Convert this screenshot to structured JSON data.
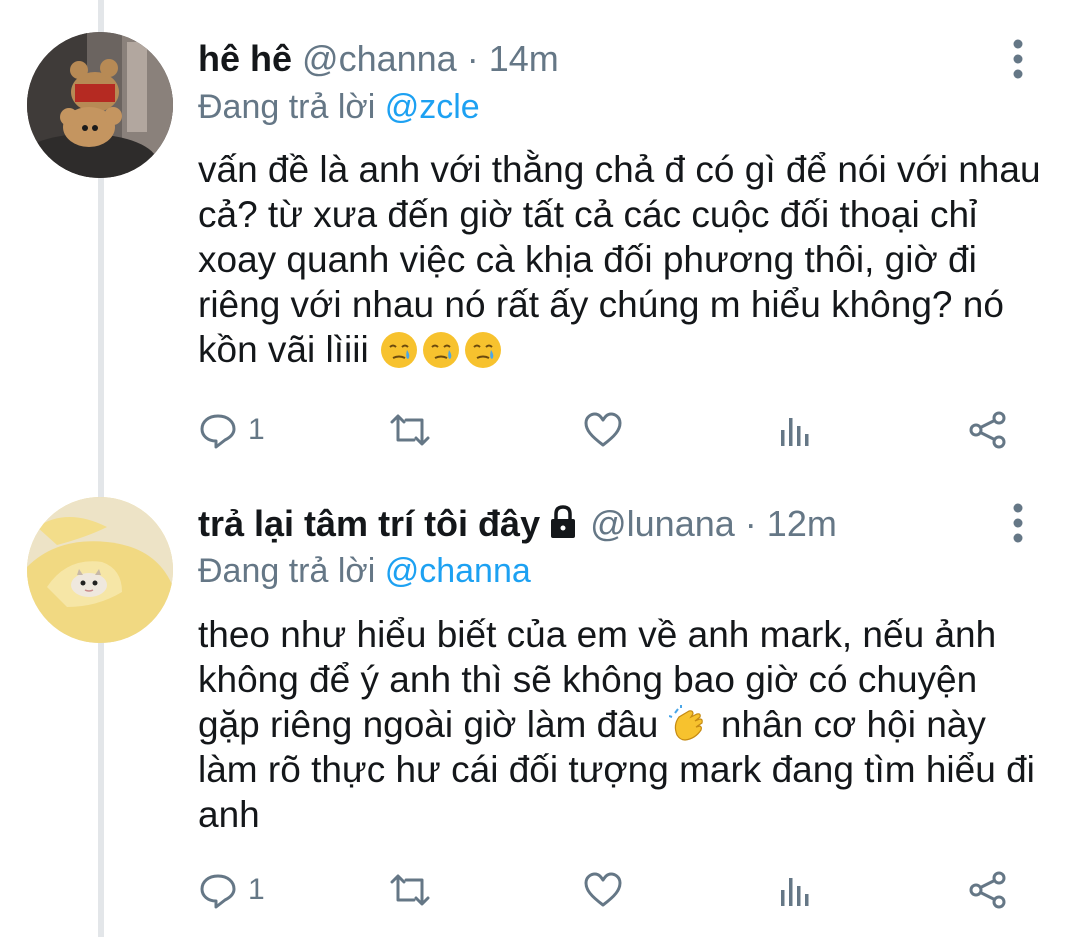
{
  "tweets": [
    {
      "name": "hê hê",
      "handle": "@channa",
      "separator": "·",
      "time": "14m",
      "replying_prefix": "Đang trả lời",
      "replying_to": "@zcle",
      "text": "vấn đề là anh với thằng chả đ có gì để nói với nhau cả? từ xưa đến giờ tất cả các cuộc đối thoại chỉ xoay quanh việc cà khịa đối phương thôi, giờ đi riêng với nhau nó rất ấy chúng m hiểu không? nó kồn vãi lìiii",
      "text_emojis": [
        "crying-face",
        "crying-face",
        "crying-face"
      ],
      "reply_count": "1",
      "avatar": "teddy-bear-avatar",
      "protected": false
    },
    {
      "name": "trả lại tâm trí tôi đây",
      "handle": "@lunana",
      "separator": "·",
      "time": "12m",
      "replying_prefix": "Đang trả lời",
      "replying_to": "@channa",
      "text_part1": "theo như hiểu biết của em về anh mark, nếu ảnh không để ý anh thì sẽ không bao giờ có chuyện gặp riêng ngoài giờ làm đâu",
      "text_part2": " nhân cơ hội này làm rõ thực hư cái đối tượng mark đang tìm hiểu đi anh",
      "text_emojis": [
        "clapping-hands"
      ],
      "reply_count": "1",
      "avatar": "cat-in-banana-avatar",
      "protected": true
    }
  ],
  "colors": {
    "text": "#14171a",
    "secondary": "#657786",
    "link": "#1da1f2",
    "thread_line": "#e3e6e9"
  }
}
